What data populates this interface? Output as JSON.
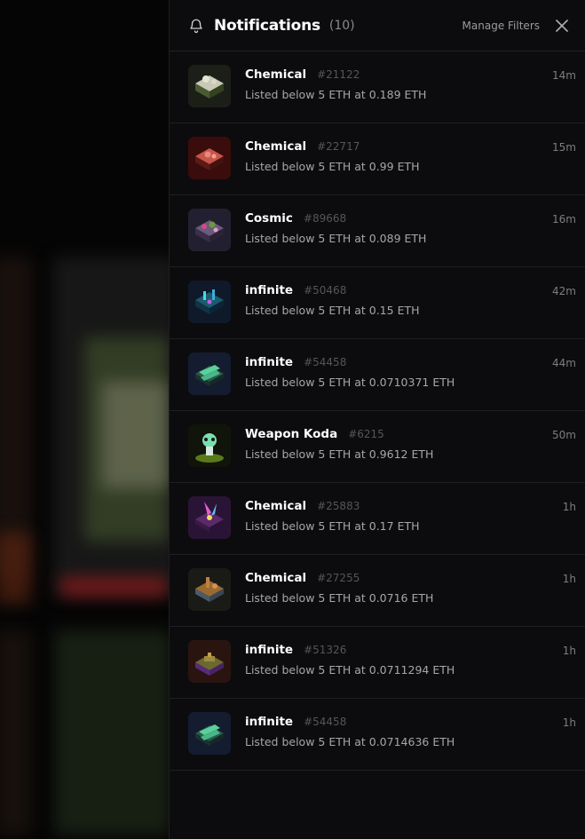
{
  "header": {
    "title": "Notifications",
    "count": "(10)",
    "manage_filters": "Manage Filters"
  },
  "notifications": [
    {
      "name": "Chemical",
      "token": "#21122",
      "message": "Listed below 5 ETH at 0.189 ETH",
      "time": "14m",
      "thumb": "thumb-chemical-white"
    },
    {
      "name": "Chemical",
      "token": "#22717",
      "message": "Listed below 5 ETH at 0.99 ETH",
      "time": "15m",
      "thumb": "thumb-chemical-red"
    },
    {
      "name": "Cosmic",
      "token": "#89668",
      "message": "Listed below 5 ETH at 0.089 ETH",
      "time": "16m",
      "thumb": "thumb-cosmic"
    },
    {
      "name": "infinite",
      "token": "#50468",
      "message": "Listed below 5 ETH at 0.15 ETH",
      "time": "42m",
      "thumb": "thumb-infinite-blue"
    },
    {
      "name": "infinite",
      "token": "#54458",
      "message": "Listed below 5 ETH at 0.0710371 ETH",
      "time": "44m",
      "thumb": "thumb-infinite-crystal"
    },
    {
      "name": "Weapon Koda",
      "token": "#6215",
      "message": "Listed below 5 ETH at 0.9612 ETH",
      "time": "50m",
      "thumb": "thumb-koda"
    },
    {
      "name": "Chemical",
      "token": "#25883",
      "message": "Listed below 5 ETH at 0.17 ETH",
      "time": "1h",
      "thumb": "thumb-chemical-purple"
    },
    {
      "name": "Chemical",
      "token": "#27255",
      "message": "Listed below 5 ETH at 0.0716 ETH",
      "time": "1h",
      "thumb": "thumb-chemical-brown"
    },
    {
      "name": "infinite",
      "token": "#51326",
      "message": "Listed below 5 ETH at 0.0711294 ETH",
      "time": "1h",
      "thumb": "thumb-infinite-earth"
    },
    {
      "name": "infinite",
      "token": "#54458",
      "message": "Listed below 5 ETH at 0.0714636 ETH",
      "time": "1h",
      "thumb": "thumb-infinite-crystal"
    }
  ],
  "icons": {
    "bell": "bell-icon",
    "close": "close-icon"
  },
  "colors": {
    "panel_bg": "#0c0c0e",
    "divider": "#1f1f23",
    "muted": "#7d7d82"
  }
}
